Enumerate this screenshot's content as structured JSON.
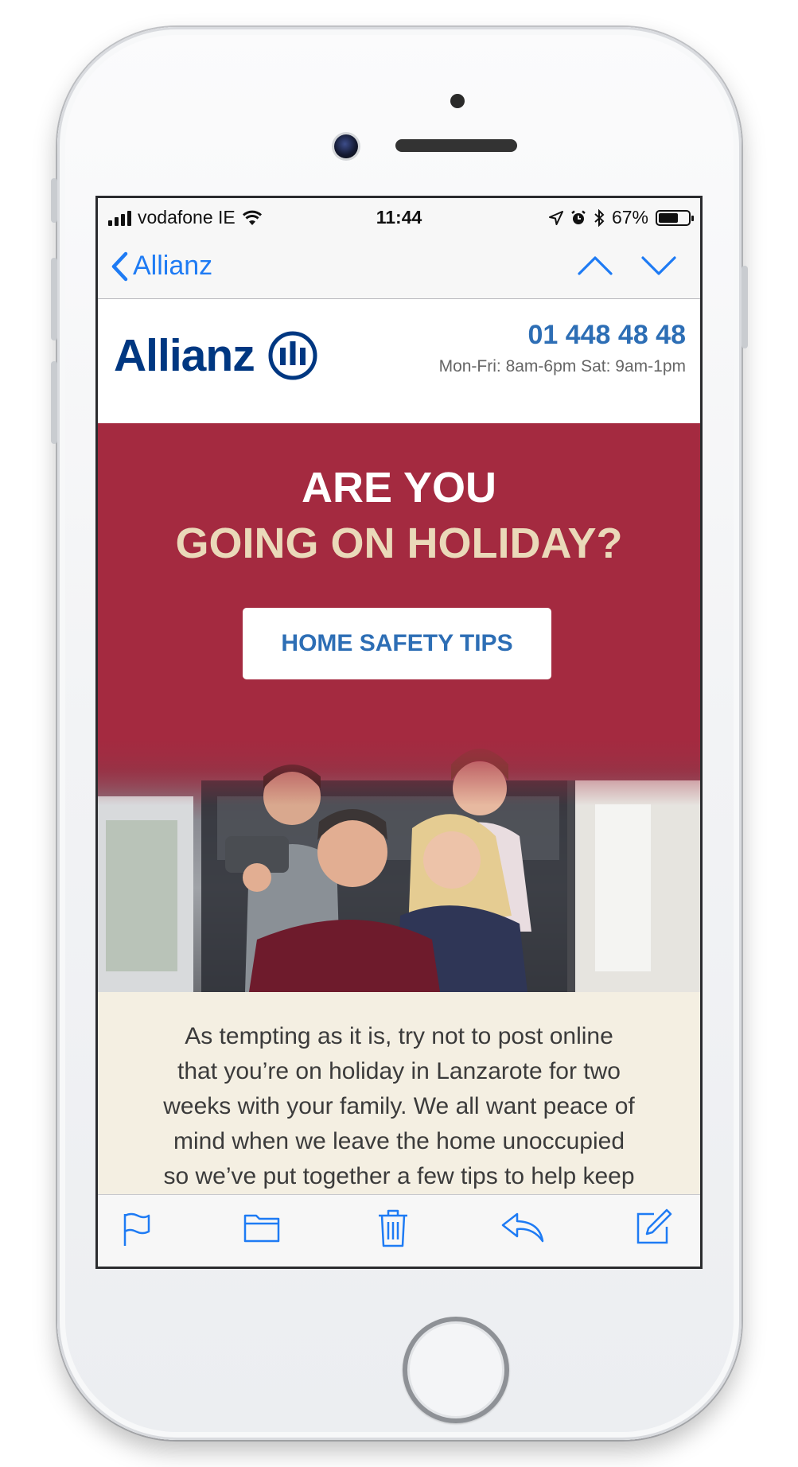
{
  "status_bar": {
    "carrier": "vodafone IE",
    "time": "11:44",
    "battery": "67%"
  },
  "nav": {
    "back_label": "Allianz"
  },
  "email": {
    "brand": "Allianz",
    "phone": "01 448 48 48",
    "hours": "Mon-Fri: 8am-6pm Sat: 9am-1pm",
    "headline_line1": "ARE YOU",
    "headline_line2": "GOING ON HOLIDAY?",
    "cta_label": "HOME SAFETY TIPS",
    "body_lines": [
      "As tempting as it is, try not to post online",
      "that you’re on holiday in Lanzarote for two",
      "weeks with your family. We all want peace of",
      "mind when we leave the home unoccupied",
      "so we’ve put together a few tips to help keep"
    ]
  },
  "colors": {
    "ios_blue": "#1e7bf4",
    "allianz_navy": "#003781",
    "link_blue": "#2d6eb5",
    "hero_red": "#a42a40",
    "headline_cream": "#ead9b9",
    "body_bg": "#f4efe2"
  },
  "toolbar": {
    "icons": [
      "flag-icon",
      "folder-icon",
      "trash-icon",
      "reply-icon",
      "compose-icon"
    ]
  }
}
